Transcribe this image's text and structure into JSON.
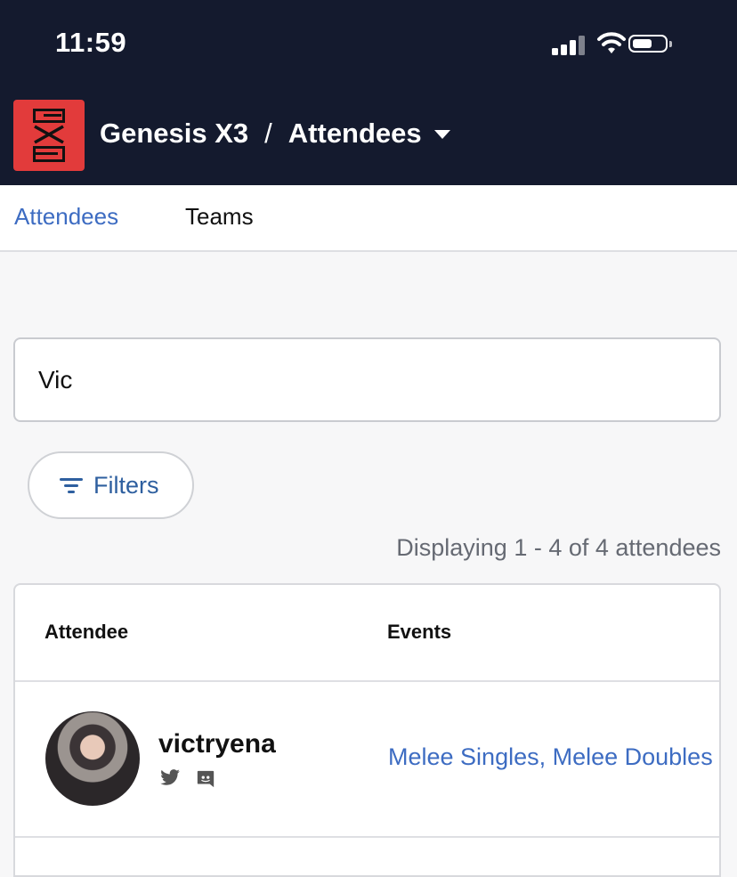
{
  "status_bar": {
    "time": "11:59",
    "icons": [
      "signal-icon",
      "wifi-icon",
      "battery-icon"
    ]
  },
  "header": {
    "logo": "genesis-x3-logo",
    "event_name": "Genesis X3",
    "separator": "/",
    "section": "Attendees"
  },
  "tabs": [
    {
      "label": "Attendees",
      "active": true
    },
    {
      "label": "Teams",
      "active": false
    }
  ],
  "search": {
    "value": "Vic"
  },
  "filters": {
    "label": "Filters"
  },
  "results": {
    "summary": "Displaying 1 - 4 of 4 attendees"
  },
  "table": {
    "columns": [
      "Attendee",
      "Events"
    ],
    "rows": [
      {
        "name": "victryena",
        "social_icons": [
          "twitter-icon",
          "discord-icon"
        ],
        "events": "Melee Singles, Melee Doubles"
      }
    ]
  },
  "colors": {
    "header_bg": "#141a2e",
    "logo_bg": "#e23b3b",
    "link": "#3d6cc2",
    "filter_text": "#2e5f9f"
  }
}
